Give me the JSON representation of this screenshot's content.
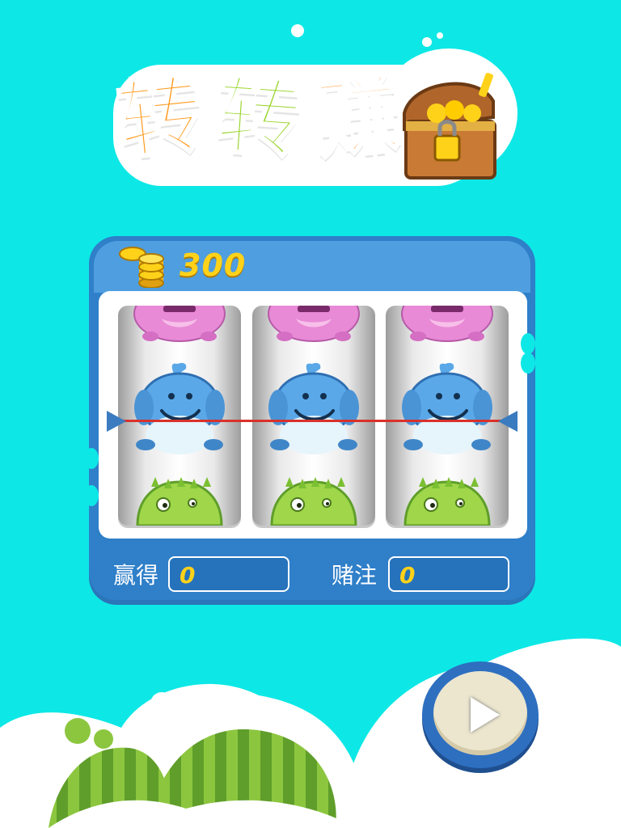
{
  "title": {
    "chars": [
      "转",
      "转",
      "赚"
    ]
  },
  "machine": {
    "credits": "300",
    "reels": [
      {
        "top": "pink-monster-icon",
        "middle": "blue-whale-icon",
        "bottom": "green-monster-icon"
      },
      {
        "top": "pink-monster-icon",
        "middle": "blue-whale-icon",
        "bottom": "green-monster-icon"
      },
      {
        "top": "pink-monster-icon",
        "middle": "blue-whale-icon",
        "bottom": "green-monster-icon"
      }
    ],
    "win_label": "赢得",
    "win_value": "0",
    "bet_label": "赌注",
    "bet_value": "0"
  },
  "colors": {
    "background": "#0de8e6",
    "machine": "#2f7fc9",
    "digits": "#ffd21a",
    "payline": "#d9312b"
  },
  "icons": {
    "chest": "treasure-chest-icon",
    "coins": "coin-stack-icon",
    "play": "play-icon"
  }
}
